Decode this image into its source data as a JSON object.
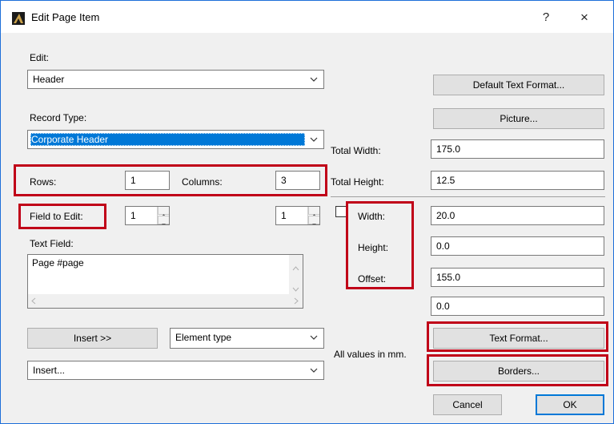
{
  "window": {
    "title": "Edit Page Item",
    "help_label": "?",
    "close_label": "×"
  },
  "left": {
    "edit_label": "Edit:",
    "edit_value": "Header",
    "record_type_label": "Record Type:",
    "record_type_value": "Corporate Header",
    "rows_label": "Rows:",
    "rows_value": "1",
    "columns_label": "Columns:",
    "columns_value": "3",
    "field_to_edit_label": "Field to Edit:",
    "field_row_value": "1",
    "field_col_value": "1",
    "text_field_label": "Text Field:",
    "text_field_value": "Page #page",
    "insert_button": "Insert >>",
    "element_type_value": "Element type",
    "insert_dropdown_value": "Insert..."
  },
  "right": {
    "default_text_format_button": "Default Text Format...",
    "picture_button": "Picture...",
    "total_width_label": "Total Width:",
    "total_width_value": "175.0",
    "total_height_label": "Total Height:",
    "total_height_value": "12.5",
    "width_label": "Width:",
    "width_value": "20.0",
    "height_label": "Height:",
    "height_value": "0.0",
    "offset_label": "Offset:",
    "offset_value": "155.0",
    "extra_value": "0.0",
    "text_format_button": "Text Format...",
    "borders_button": "Borders...",
    "units_note": "All values in mm.",
    "cancel_button": "Cancel",
    "ok_button": "OK"
  },
  "colors": {
    "highlight_red": "#c00018",
    "selection_blue": "#0078d7",
    "window_border": "#1e6fd9"
  },
  "icons": {
    "app": "archicad-icon",
    "chevron": "chevron-down-icon"
  }
}
